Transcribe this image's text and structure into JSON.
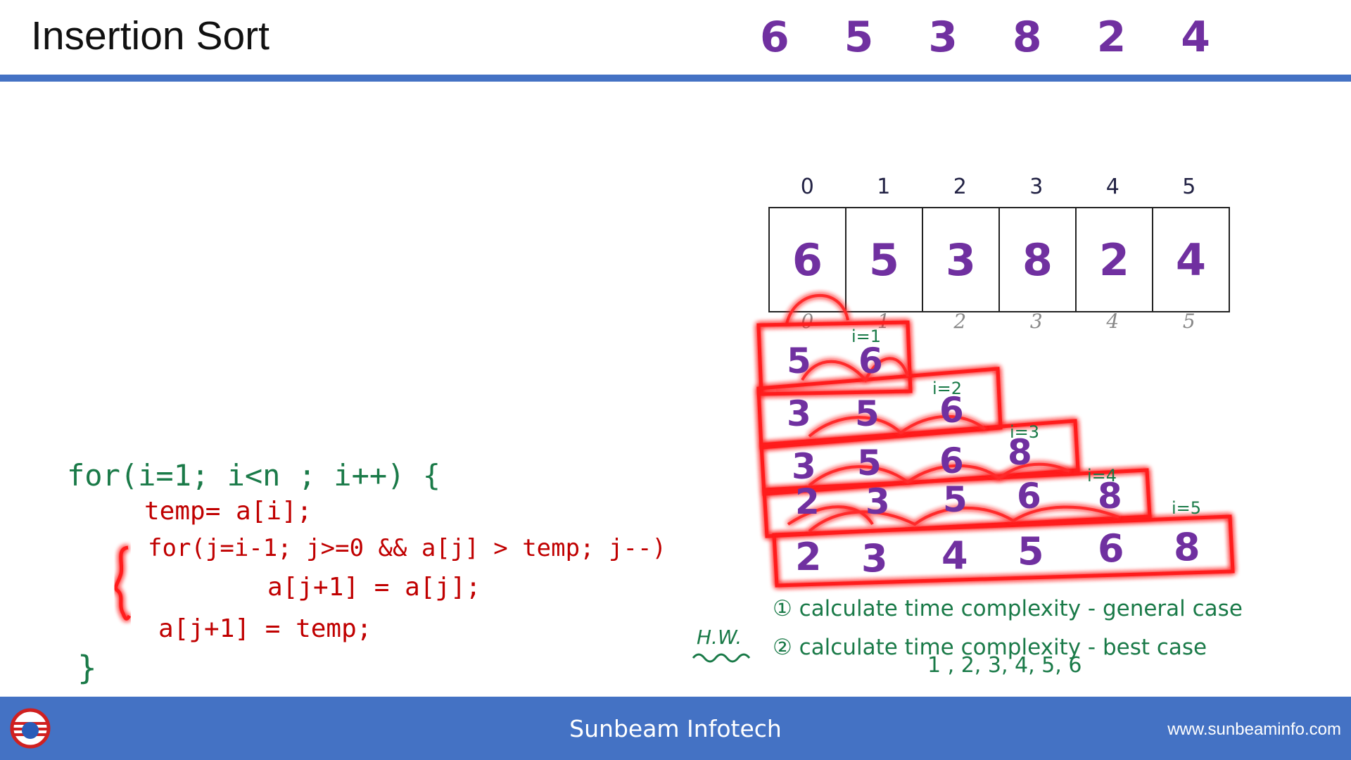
{
  "slide": {
    "title": "Insertion Sort"
  },
  "header_array": [
    "6",
    "5",
    "3",
    "8",
    "2",
    "4"
  ],
  "array": {
    "indices": [
      "0",
      "1",
      "2",
      "3",
      "4",
      "5"
    ],
    "values": [
      "6",
      "5",
      "3",
      "8",
      "2",
      "4"
    ],
    "sub_indices": [
      "0",
      "1",
      "2",
      "3",
      "4",
      "5"
    ]
  },
  "passes": [
    {
      "label": "i=1",
      "values": [
        "5",
        "6"
      ]
    },
    {
      "label": "i=2",
      "values": [
        "3",
        "5",
        "6"
      ]
    },
    {
      "label": "i=3",
      "values": [
        "3",
        "5",
        "6",
        "8"
      ]
    },
    {
      "label": "i=4",
      "values": [
        "2",
        "3",
        "5",
        "6",
        "8"
      ]
    },
    {
      "label": "i=5",
      "values": [
        "2",
        "3",
        "4",
        "5",
        "6",
        "8"
      ]
    }
  ],
  "code": {
    "line1": "for(i=1; i<n ; i++) {",
    "line2": "temp= a[i];",
    "line3": "for(j=i-1; j>=0 && a[j] > temp; j--)",
    "line4": "a[j+1] = a[j];",
    "line5": "a[j+1] = temp;",
    "line6": "}"
  },
  "homework": {
    "label": "H.W.",
    "item1": "① calculate time complexity - general case",
    "item2": "② calculate time complexity - best case",
    "item2_example": "1 , 2, 3, 4, 5, 6"
  },
  "footer": {
    "center_text": "Sunbeam Infotech",
    "url": "www.sunbeaminfo.com"
  },
  "colors": {
    "accent_bar": "#4472c4",
    "numbers": "#7030a0",
    "code_green": "#1a7a48",
    "code_red": "#c00000",
    "highlight_glow": "#ff1a1a"
  }
}
